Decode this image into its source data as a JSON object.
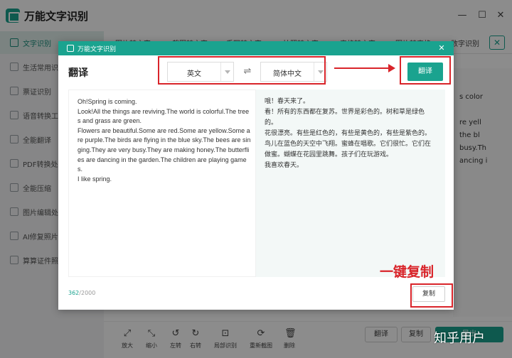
{
  "window": {
    "title": "万能文字识别",
    "minimize_glyph": "—",
    "maximize_glyph": "☐",
    "close_glyph": "✕"
  },
  "sidebar": {
    "items": [
      {
        "label": "文字识别",
        "active": true
      },
      {
        "label": "生活常用识别"
      },
      {
        "label": "票证识别"
      },
      {
        "label": "语音转换工具"
      },
      {
        "label": "全能翻译"
      },
      {
        "label": "PDF转换处理"
      },
      {
        "label": "全能压缩"
      },
      {
        "label": "图片编辑处理"
      },
      {
        "label": "AI修复照片"
      },
      {
        "label": "算算证件照"
      }
    ]
  },
  "tabs": [
    "图片转文字",
    "截图转文字",
    "手写转文字",
    "拍照转文字",
    "表格转文字",
    "图片转表格",
    "数字识别"
  ],
  "background_text": [
    "s color",
    "re yell",
    "the bl",
    "busy.Th",
    "ancing i"
  ],
  "toolbar": {
    "tools": [
      {
        "label": "放大",
        "icon": "expand-icon"
      },
      {
        "label": "缩小",
        "icon": "shrink-icon"
      },
      {
        "label": "左转",
        "icon": "rotate-left-icon"
      },
      {
        "label": "右转",
        "icon": "rotate-right-icon"
      },
      {
        "label": "局部识别",
        "icon": "crop-icon"
      },
      {
        "label": "重新截图",
        "icon": "refresh-icon"
      },
      {
        "label": "删除",
        "icon": "trash-icon"
      }
    ],
    "translate_label": "翻译",
    "copy_label": "复制",
    "export_label": "导出"
  },
  "modal": {
    "header_title": "万能文字识别",
    "heading": "翻译",
    "source_lang": "英文",
    "target_lang": "简体中文",
    "swap_glyph": "⇌",
    "translate_label": "翻译",
    "source_text": "Oh!Spring is coming.\nLook!All the things are reviving.The world is colorful.The trees and grass are green.\nFlowers are beautiful.Some are red.Some are yellow.Some are purple.The birds are flying in the blue sky.The bees are singing.They are very busy.They are making honey.The butterflies are dancing in the garden.The children are playing games.\nI like spring.",
    "target_text": "哦！春天来了。\n看！所有的东西都在复苏。世界是彩色的。树和草是绿色的。\n花很漂亮。有些是红色的，有些是黄色的，有些是紫色的。鸟儿在蓝色的天空中飞翔。蜜蜂在唱歌。它们很忙。它们在做蜜。蝴蝶在花园里跳舞。孩子们在玩游戏。\n我喜欢春天。",
    "char_count_current": "362",
    "char_count_max": "/2000",
    "copy_label": "复制"
  },
  "annotation": {
    "text": "一键复制",
    "color": "#d9242a"
  },
  "watermark": "知乎用户",
  "colors": {
    "accent": "#1aa38f",
    "annotation_red": "#d9242a"
  }
}
